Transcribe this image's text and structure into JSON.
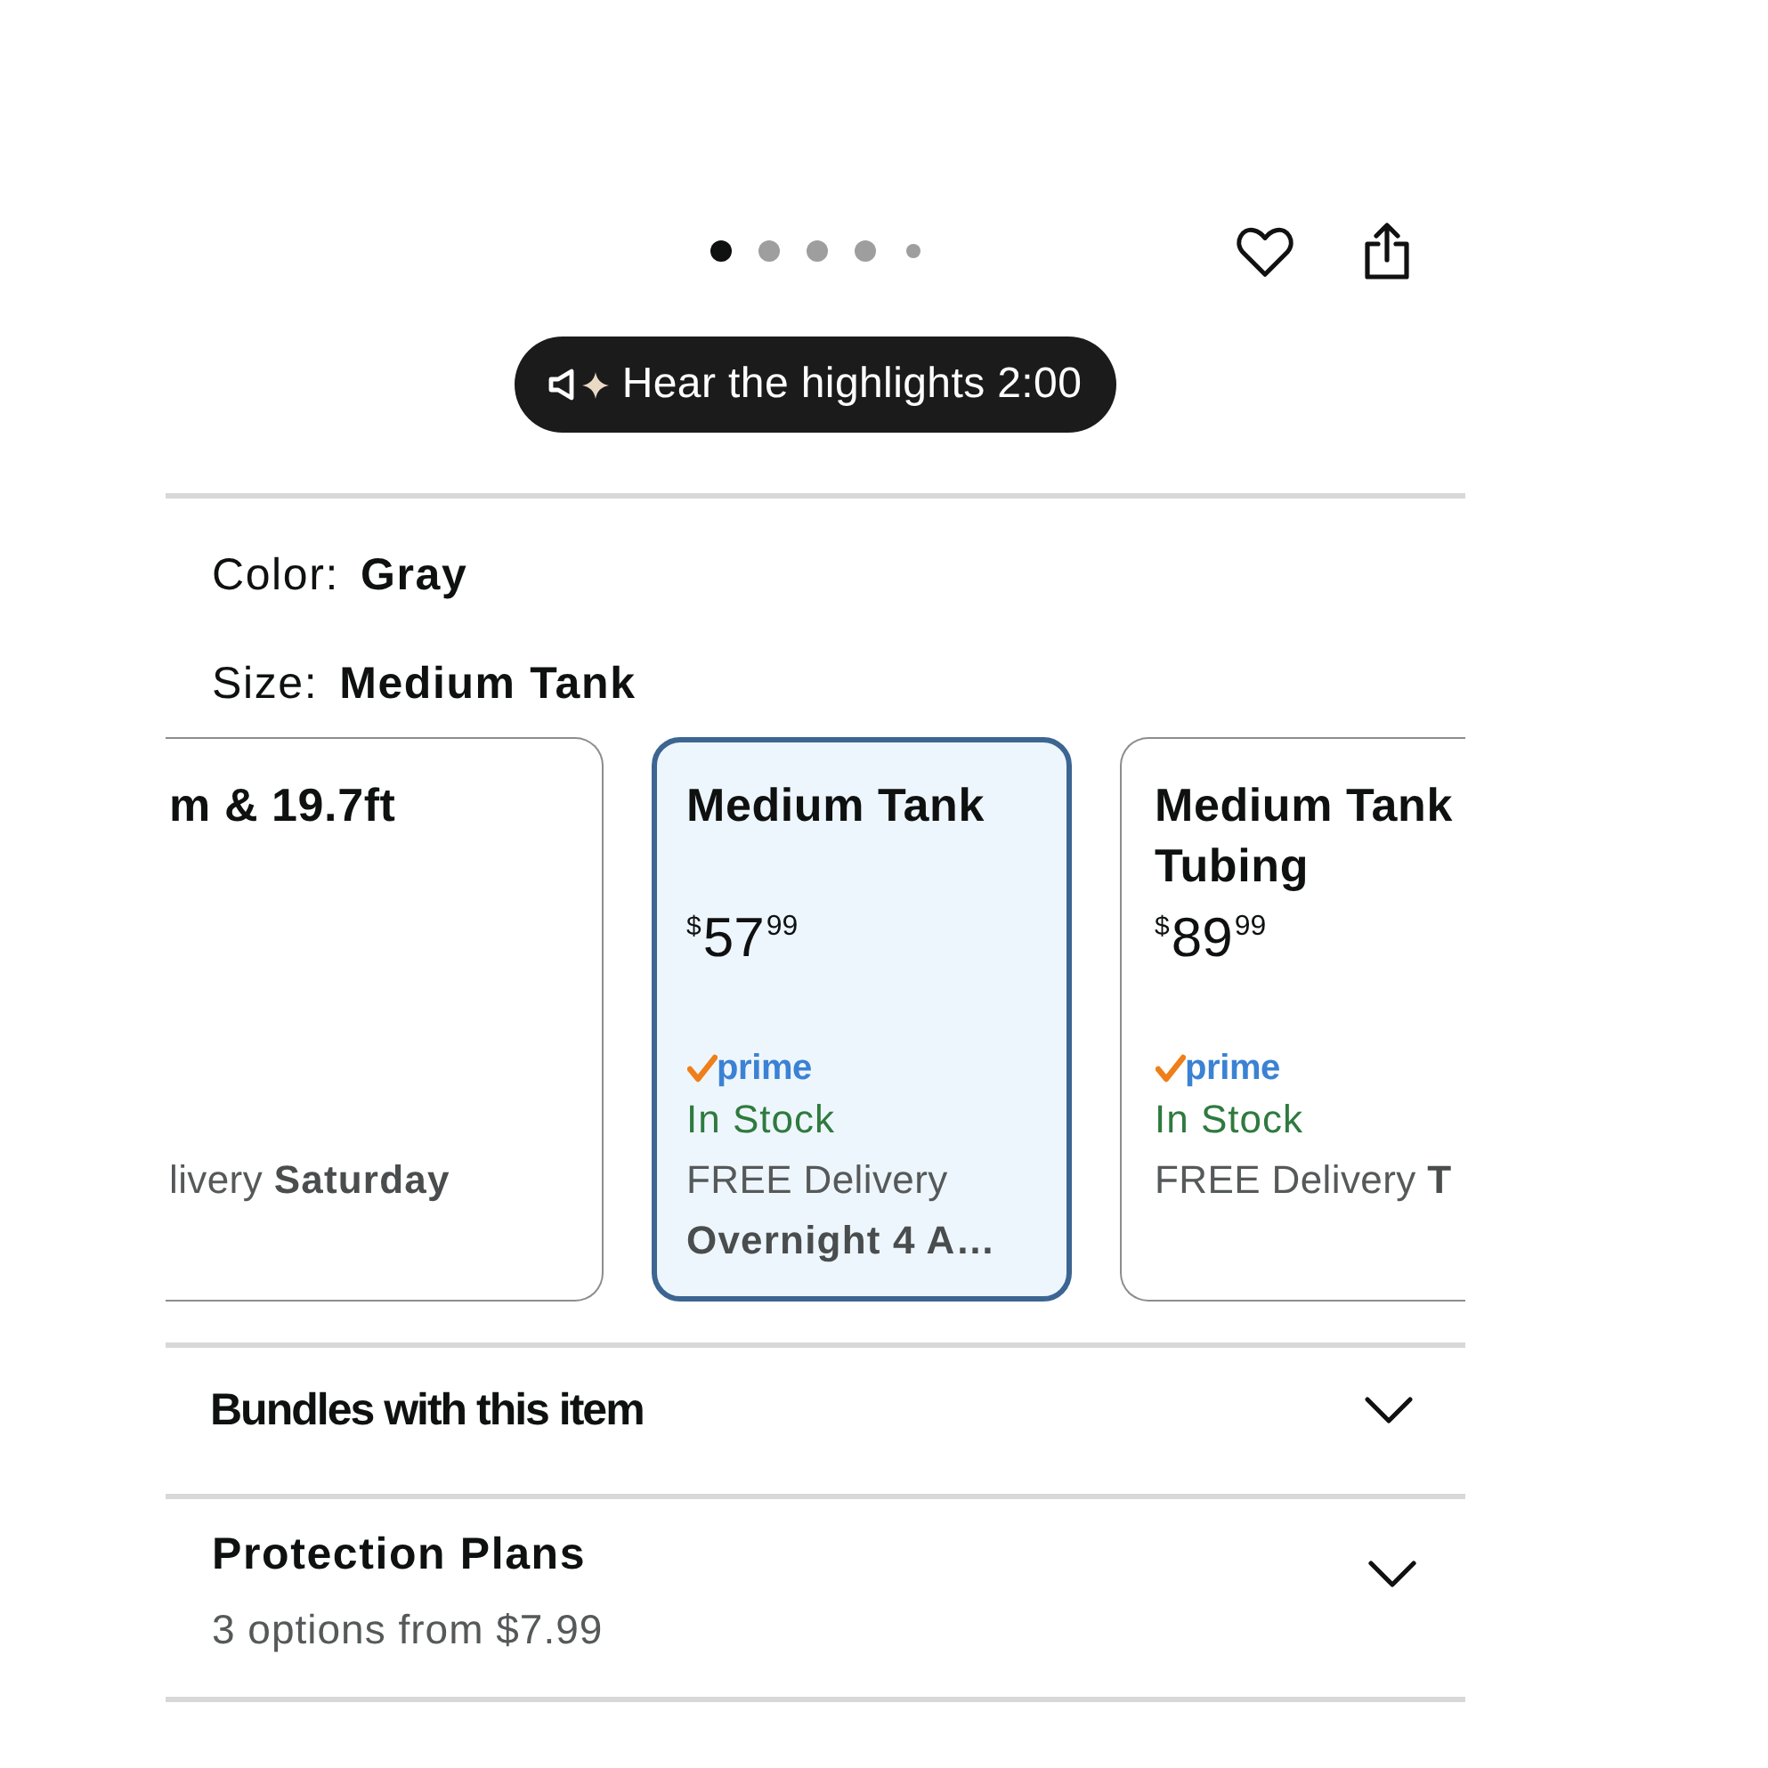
{
  "carousel": {
    "dots": [
      {
        "kind": "page",
        "selected": true
      },
      {
        "kind": "page",
        "selected": false
      },
      {
        "kind": "page",
        "selected": false
      },
      {
        "kind": "page",
        "selected": false
      },
      {
        "kind": "more",
        "selected": false
      }
    ]
  },
  "audio_button": {
    "label": "Hear the highlights 2:00"
  },
  "variations": [
    {
      "label": "Color:",
      "value": "Gray"
    },
    {
      "label": "Size:",
      "value": "Medium Tank"
    }
  ],
  "size_options": [
    {
      "title": "m & 19.7ft",
      "delivery": "livery **Saturday**",
      "selected": false
    },
    {
      "title": "Medium Tank",
      "price": {
        "symbol": "$",
        "whole": "57",
        "fraction": "99"
      },
      "badge": "prime",
      "stock": "In Stock",
      "delivery": "FREE Delivery **Overnight 4 A…**",
      "selected": true
    },
    {
      "title": "Medium Tank Tubing",
      "price": {
        "symbol": "$",
        "whole": "89",
        "fraction": "99"
      },
      "badge": "prime",
      "stock": "In Stock",
      "delivery": "FREE Delivery **T**",
      "selected": false
    }
  ],
  "sections": [
    {
      "kind": "display",
      "title": "Bundles with this item",
      "expanded": false
    },
    {
      "kind": "standard",
      "title": "Protection Plans",
      "subtitle": "3 options from $7.99",
      "expanded": false
    }
  ]
}
